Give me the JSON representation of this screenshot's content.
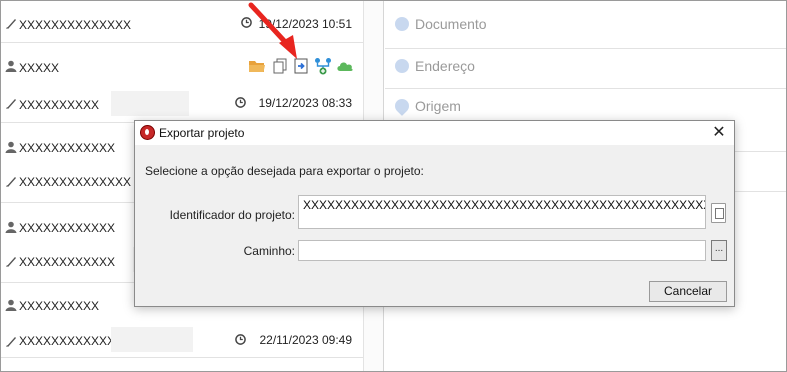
{
  "list": {
    "rows": [
      {
        "icon": "pen-icon",
        "text": "XXXXXXXXXXXXXX",
        "time": "19/12/2023 10:51"
      },
      {
        "icon": "user-icon",
        "text": "XXXXX",
        "time": ""
      },
      {
        "icon": "pen-icon",
        "text": "XXXXXXXXXX",
        "time": "19/12/2023 08:33"
      },
      {
        "icon": "user-icon",
        "text": "XXXXXXXXXXXX",
        "time": ""
      },
      {
        "icon": "pen-icon",
        "text": "XXXXXXXXXXXXXX",
        "time": ""
      },
      {
        "icon": "user-icon",
        "text": "XXXXXXXXXXXX",
        "time": ""
      },
      {
        "icon": "pen-icon",
        "text": "XXXXXXXXXXXX",
        "time": ""
      },
      {
        "icon": "user-icon",
        "text": "XXXXXXXXXX",
        "time": ""
      },
      {
        "icon": "pen-icon",
        "text": "XXXXXXXXXXXX",
        "time": "22/11/2023 09:49"
      }
    ]
  },
  "right": {
    "items": [
      {
        "icon": "plus-circle-icon",
        "label": "Documento"
      },
      {
        "icon": "plus-circle-icon",
        "label": "Endereço"
      },
      {
        "icon": "map-pin-icon",
        "label": "Origem"
      }
    ]
  },
  "dialog": {
    "title": "Exportar projeto",
    "instruction": "Selecione a opção desejada para exportar o projeto:",
    "project_id_label": "Identificador do projeto:",
    "project_id_value": "XXXXXXXXXXXXXXXXXXXXXXXXXXXXXXXXXXXXXXXXXXXXXXXXXXXX",
    "path_label": "Caminho:",
    "path_value": "",
    "browse_label": "...",
    "cancel_label": "Cancelar"
  },
  "colors": {
    "arrow": "#e8251f",
    "folder": "#e8a23c",
    "export": "#2b6fd6",
    "share": "#2f8fd8",
    "cloud": "#5cb85c"
  }
}
